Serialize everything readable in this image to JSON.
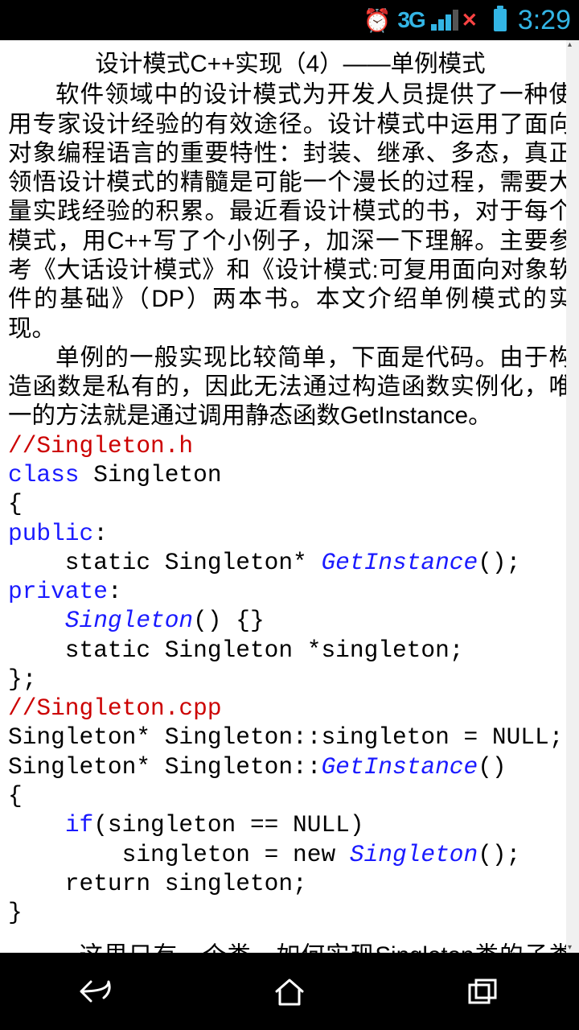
{
  "status": {
    "net": "3G",
    "clock": "3:29"
  },
  "doc": {
    "title": "设计模式C++实现（4）——单例模式",
    "para1": "软件领域中的设计模式为开发人员提供了一种使用专家设计经验的有效途径。设计模式中运用了面向对象编程语言的重要特性：封装、继承、多态，真正领悟设计模式的精髓是可能一个漫长的过程，需要大量实践经验的积累。最近看设计模式的书，对于每个模式，用C++写了个小例子，加深一下理解。主要参考《大话设计模式》和《设计模式:可复用面向对象软件的基础》（DP）两本书。本文介绍单例模式的实现。",
    "para2": "单例的一般实现比较简单，下面是代码。由于构造函数是私有的，因此无法通过构造函数实例化，唯一的方法就是通过调用静态函数GetInstance。",
    "code": {
      "c1": "//Singleton.h",
      "c2a": "class",
      "c2b": " Singleton",
      "c3": "{",
      "c4a": "public",
      "c4b": ":",
      "c5a": "    static Singleton* ",
      "c5b": "GetInstance",
      "c5c": "();",
      "c6a": "private",
      "c6b": ":",
      "c7a": "    ",
      "c7b": "Singleton",
      "c7c": "() {}",
      "c8": "    static Singleton *singleton;",
      "c9": "};",
      "c10": "//Singleton.cpp",
      "c11": "Singleton* Singleton::singleton = NULL;",
      "c12a": "Singleton* Singleton::",
      "c12b": "GetInstance",
      "c12c": "()",
      "c13": "{",
      "c14a": "    ",
      "c14b": "if",
      "c14c": "(singleton == NULL)",
      "c15a": "        singleton = new ",
      "c15b": "Singleton",
      "c15c": "();",
      "c16": "    return singleton;",
      "c17": "}"
    },
    "para3": "这里只有一个类，如何实现Singleton类的子类呢？也就说Singleton有很多子类，在一种应用中，只选择"
  }
}
